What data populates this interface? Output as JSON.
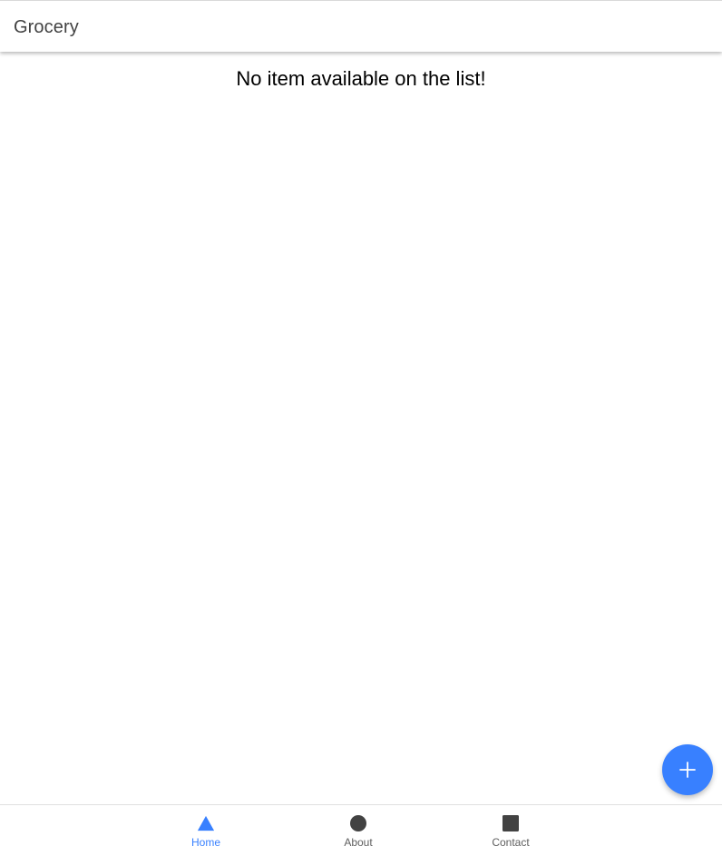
{
  "toolbar": {
    "title": "Grocery"
  },
  "content": {
    "empty_message": "No item available on the list!"
  },
  "fab": {
    "icon": "add-icon"
  },
  "tabs": [
    {
      "label": "Home",
      "icon": "triangle-icon",
      "selected": true
    },
    {
      "label": "About",
      "icon": "circle-icon",
      "selected": false
    },
    {
      "label": "Contact",
      "icon": "square-icon",
      "selected": false
    }
  ],
  "colors": {
    "primary": "#3880ff",
    "tab_inactive": "#5f5f5f",
    "icon_inactive": "#424242",
    "title_text": "#424242"
  }
}
